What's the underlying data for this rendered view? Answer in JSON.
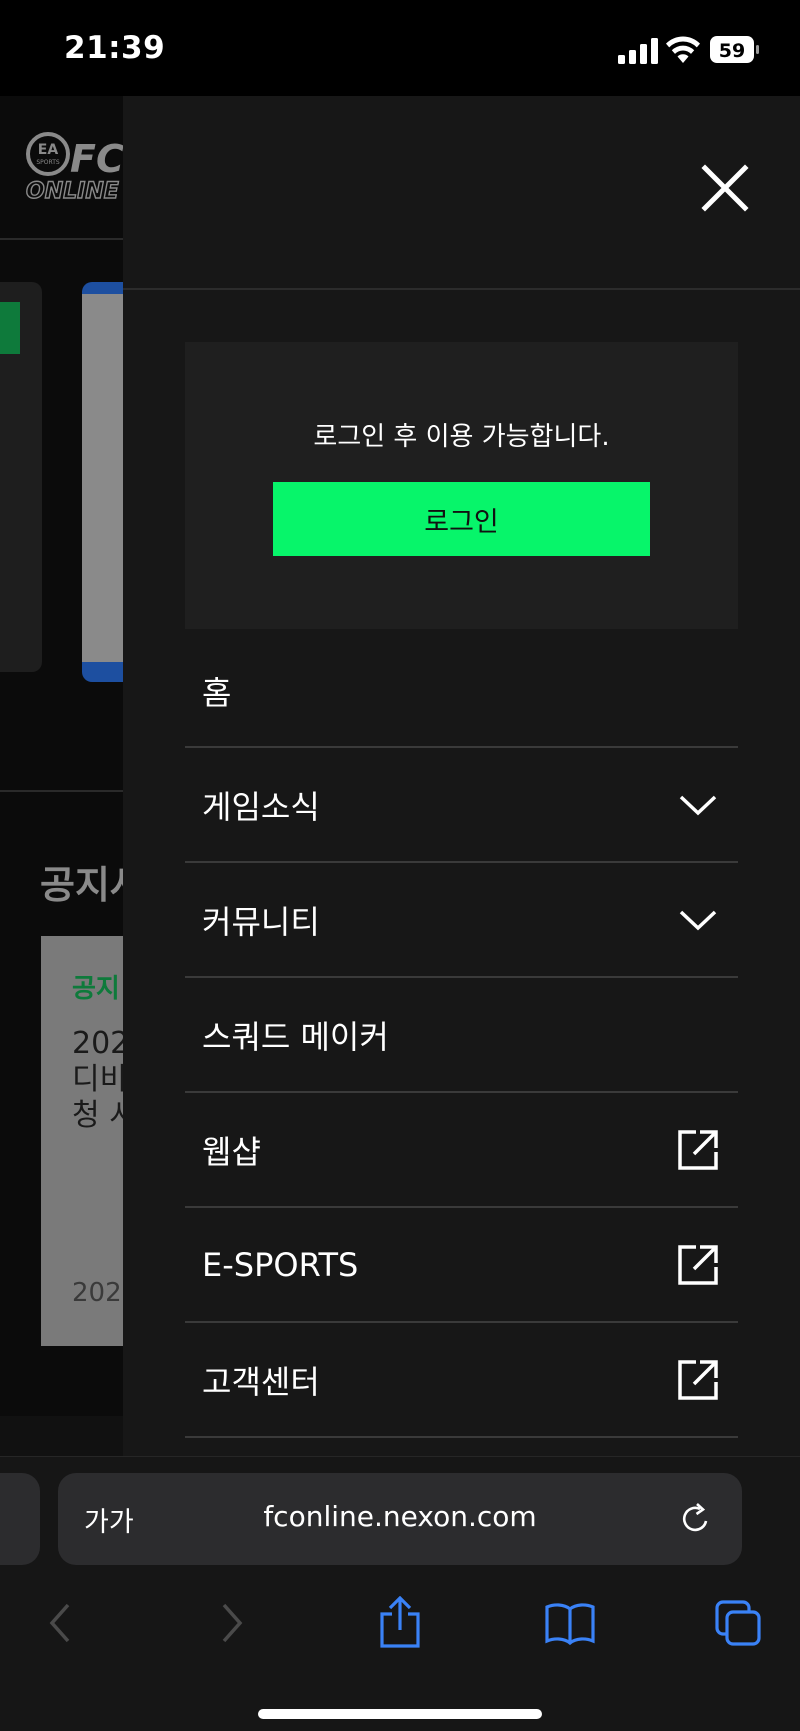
{
  "status_bar": {
    "time": "21:39",
    "battery": "59"
  },
  "background_page": {
    "logo_text": "EA SPORTS FC ONLINE",
    "notice_section_title": "공지사",
    "notice_tag": "공지",
    "notice_text": "202\n디비\n청 시",
    "notice_date": "202"
  },
  "drawer": {
    "login_message": "로그인 후 이용 가능합니다.",
    "login_button": "로그인",
    "menu": [
      {
        "label": "홈",
        "icon": "none"
      },
      {
        "label": "게임소식",
        "icon": "chevron-down-icon"
      },
      {
        "label": "커뮤니티",
        "icon": "chevron-down-icon"
      },
      {
        "label": "스쿼드 메이커",
        "icon": "none"
      },
      {
        "label": "웹샵",
        "icon": "external-link-icon"
      },
      {
        "label": "E-SPORTS",
        "icon": "external-link-icon"
      },
      {
        "label": "고객센터",
        "icon": "external-link-icon"
      }
    ]
  },
  "browser": {
    "text_size_button": "가가",
    "url": "fconline.nexon.com"
  },
  "colors": {
    "accent": "#07f56a",
    "drawer_bg": "#171717",
    "safari_blue": "#3a82f7"
  }
}
